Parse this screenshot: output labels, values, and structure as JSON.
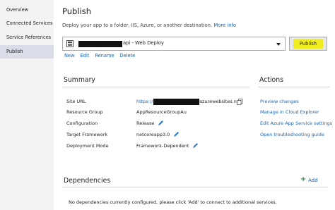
{
  "sidebar": {
    "items": [
      {
        "label": "Overview"
      },
      {
        "label": "Connected Services"
      },
      {
        "label": "Service References"
      },
      {
        "label": "Publish"
      }
    ]
  },
  "header": {
    "title": "Publish",
    "subtitle": "Deploy your app to a folder, IIS, Azure, or another destination.",
    "more_info": "More info"
  },
  "profile": {
    "selected": "api - Web Deploy",
    "publish_label": "Publish",
    "actions": [
      "New",
      "Edit",
      "Rename",
      "Delete"
    ]
  },
  "summary": {
    "title": "Summary",
    "rows": [
      {
        "label": "Site URL",
        "value": "https://",
        "value_suffix": ".azurewebsites.net"
      },
      {
        "label": "Resource Group",
        "value": "AppResourceGroupAu"
      },
      {
        "label": "Configuration",
        "value": "Release"
      },
      {
        "label": "Target Framework",
        "value": "netcoreapp3.0"
      },
      {
        "label": "Deployment Mode",
        "value": "Framework-Dependent"
      }
    ]
  },
  "actions": {
    "title": "Actions",
    "links": [
      "Preview changes",
      "Manage in Cloud Explorer",
      "Edit Azure App Service settings",
      "Open troubleshooting guide"
    ]
  },
  "dependencies": {
    "title": "Dependencies",
    "add_label": "Add",
    "empty_text": "No dependencies currently configured, please click 'Add' to connect to additional services."
  },
  "colors": {
    "link": "#1b63b7",
    "highlight": "#f2ed1e",
    "sidebar_bg": "#f3f3f3",
    "sidebar_active": "#dadde8"
  }
}
